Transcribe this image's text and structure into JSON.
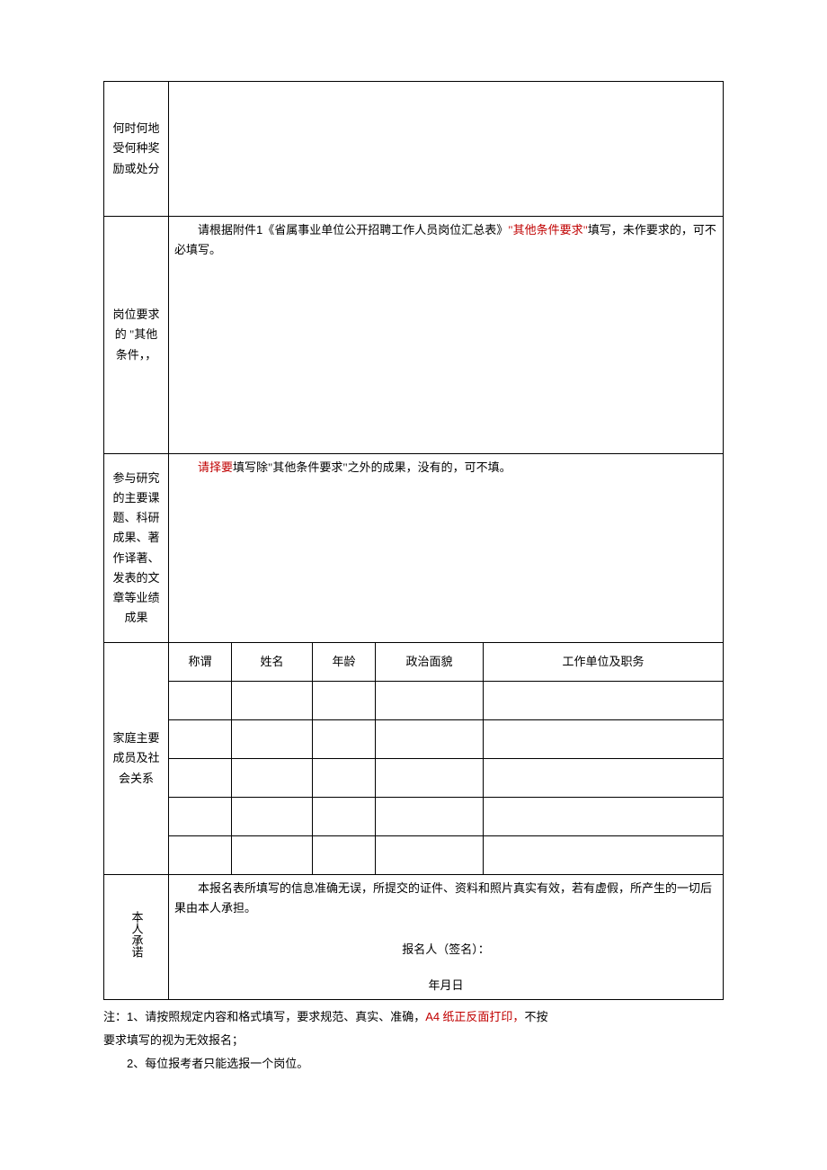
{
  "rows": {
    "awards_label": "何时何地受何种奖励或处分",
    "other_label": "岗位要求的 \"其他条件，，",
    "other_instr_pre": "请根据附件",
    "other_instr_num": "1",
    "other_instr_mid": "《省属事业单位公开招聘工作人员岗位汇总表》",
    "other_instr_red": "\"其他条件要求\"",
    "other_instr_post": "填写，未作要求的，可不必填写。",
    "research_label": "参与研究的主要课题、科研成果、著作译著、发表的文章等业绩成果",
    "research_red": "请择要",
    "research_rest": "填写除\"其他条件要求\"之外的成果，没有的，可不填。",
    "family_label": "家庭主要成员及社会关系",
    "family_headers": [
      "称谓",
      "姓名",
      "年龄",
      "政治面貌",
      "工作单位及职务"
    ],
    "decl_label": "本人承诺",
    "decl_body": "本报名表所填写的信息准确无误，所提交的证件、资料和照片真实有效，若有虚假，所产生的一切后果由本人承担。",
    "decl_sig": "报名人（签名）：",
    "decl_date": "年月日"
  },
  "notes": {
    "n1_pre": "注：",
    "n1_num": "1",
    "n1_mid": "、请按照规定内容和格式填写，要求规范、真实、准确，",
    "n1_red": "A4",
    "n1_red2": " 纸正反面打印，",
    "n1_post": "不按",
    "n1_line2": "要求填写的视为无效报名；",
    "n2_num": "2",
    "n2_text": "、每位报考者只能选报一个岗位。"
  }
}
